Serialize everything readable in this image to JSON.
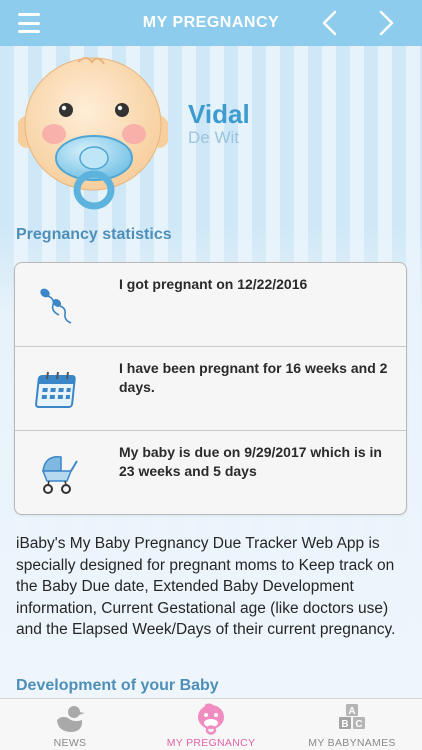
{
  "header": {
    "title": "MY PREGNANCY",
    "menu_icon": "hamburger-menu-icon",
    "prev_icon": "chevron-left-icon",
    "next_icon": "chevron-right-icon",
    "bar_color": "#8dccec"
  },
  "profile": {
    "first_name": "Vidal",
    "last_name": "De Wit",
    "avatar_icon": "baby-face-with-pacifier-icon"
  },
  "stats": {
    "title": "Pregnancy statistics",
    "rows": [
      {
        "icon": "sperm-icon",
        "text": "I got pregnant on 12/22/2016"
      },
      {
        "icon": "calendar-icon",
        "text": "I have been pregnant for 16 weeks and 2 days."
      },
      {
        "icon": "stroller-icon",
        "text": "My baby is due on 9/29/2017 which is in 23 weeks and 5 days"
      }
    ]
  },
  "description": "iBaby's My Baby Pregnancy Due Tracker Web App is specially designed for pregnant moms to Keep track on the Baby Due date, Extended Baby Development information, Current Gestational age (like doctors use) and the Elapsed Week/Days of their current pregnancy.",
  "development": {
    "title": "Development of your Baby"
  },
  "tabs": [
    {
      "label": "NEWS",
      "icon": "duck-icon",
      "active": false
    },
    {
      "label": "MY PREGNANCY",
      "icon": "baby-icon",
      "active": true
    },
    {
      "label": "MY BABYNAMES",
      "icon": "abc-blocks-icon",
      "active": false
    }
  ],
  "colors": {
    "accent": "#3d9bd0",
    "section_title": "#4e8fb8",
    "active_tab": "#e364a6"
  }
}
